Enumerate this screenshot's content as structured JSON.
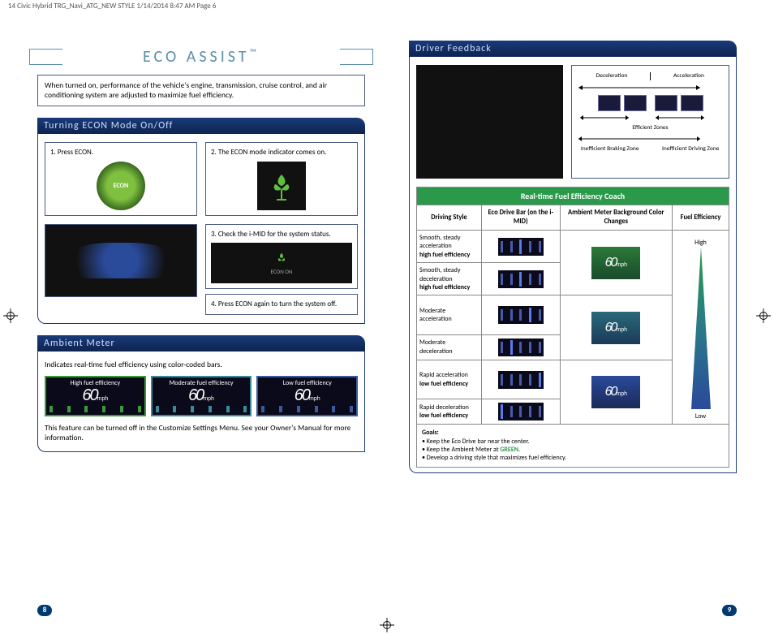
{
  "header_strip": "14 Civic Hybrid TRG_Navi_ATG_NEW STYLE  1/14/2014  8:47 AM  Page 6",
  "page_left_num": "8",
  "page_right_num": "9",
  "left": {
    "title_main": "ECO ASSIST",
    "title_tm": "™",
    "intro": "When turned on, performance of the vehicle's engine, transmission, cruise control, and air conditioning system are adjusted to maximize fuel efficiency.",
    "sec1_title": "Turning ECON Mode On/Off",
    "step1": "1.  Press ECON.",
    "econ_btn_label": "ECON",
    "step2": "2.  The ECON mode indicator comes on.",
    "step3": "3.  Check the i-MID for the system status.",
    "econ_on_label": "ECON ON",
    "step4": "4.  Press ECON again to turn the system off.",
    "sec2_title": "Ambient Meter",
    "ambient_intro": "Indicates real-time fuel efficiency using color-coded bars.",
    "ambient_labels": [
      "High fuel efficiency",
      "Moderate fuel efficiency",
      "Low fuel efficiency"
    ],
    "speed_val": "60",
    "speed_unit": "mph",
    "ambient_note": "This feature can be turned off in the Customize Settings Menu. See your Owner's Manual for more information."
  },
  "right": {
    "sec_title": "Driver Feedback",
    "zone": {
      "decel": "Deceleration",
      "accel": "Acceleration",
      "eff": "Efficient Zones",
      "ineff_brake": "Inefficient Braking Zone",
      "ineff_drive": "Inefficient Driving Zone"
    },
    "coach_title": "Real-time Fuel Efficiency Coach",
    "coach_headers": [
      "Driving Style",
      "Eco Drive Bar (on the i-MID)",
      "Ambient Meter Background Color Changes",
      "Fuel Efficiency"
    ],
    "rows": [
      {
        "style_a": "Smooth, steady acceleration",
        "style_b": "high fuel efficiency"
      },
      {
        "style_a": "Smooth, steady deceleration",
        "style_b": "high fuel efficiency"
      },
      {
        "style_a": "Moderate acceleration",
        "style_b": ""
      },
      {
        "style_a": "Moderate deceleration",
        "style_b": ""
      },
      {
        "style_a": "Rapid acceleration",
        "style_b": "low fuel efficiency"
      },
      {
        "style_a": "Rapid deceleration",
        "style_b": "low fuel efficiency"
      }
    ],
    "eff_high": "High",
    "eff_low": "Low",
    "goals_title": "Goals:",
    "goals": [
      "Keep the Eco Drive bar near the center.",
      "Keep the Ambient Meter at ",
      "Develop a driving style that maximizes fuel efficiency."
    ],
    "goals_green": "GREEN"
  }
}
